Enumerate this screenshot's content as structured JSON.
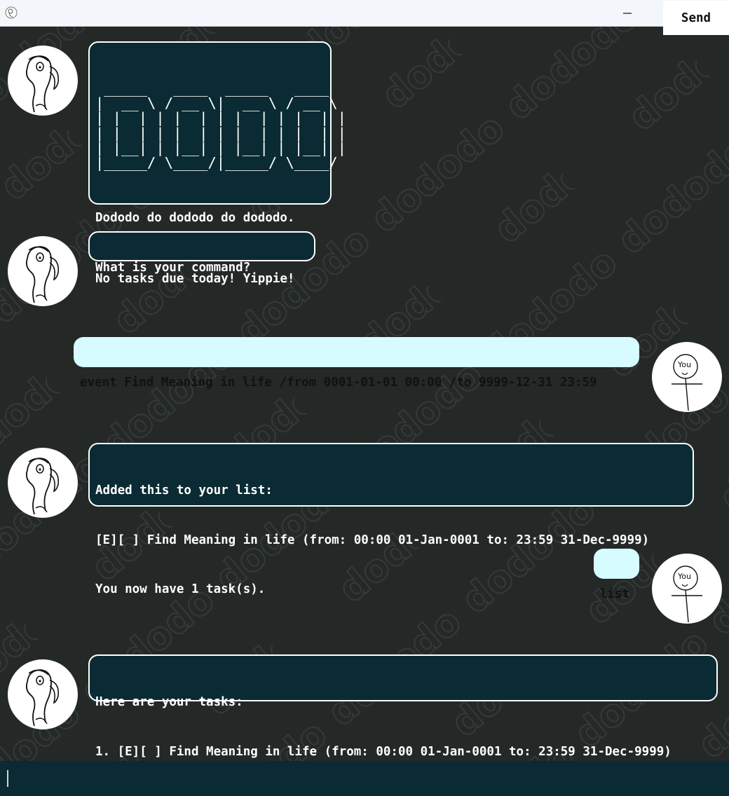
{
  "window": {
    "minimize_glyph": "—",
    "maximize_glyph": "☐",
    "close_glyph": "✕"
  },
  "messages": [
    {
      "sender": "duke",
      "ascii_art": " _____   ____  _____   ____  \n|  __ \\ / __ \\|  __ \\ / __ \\ \n| |  | | |  | | |  | | |  | |\n| |  | | |  | | |  | | |  | |\n| |__| | |__| | |__| | |__| |\n|_____/ \\____/|_____/ \\____/ ",
      "lines": [
        "Dododo do dododo do dododo.",
        "What is your command?"
      ]
    },
    {
      "sender": "duke",
      "color": "green",
      "lines": [
        "No tasks due today! Yippie!"
      ]
    },
    {
      "sender": "user",
      "lines": [
        "event Find Meaning in life /from 0001-01-01 00:00 /to 9999-12-31 23:59"
      ]
    },
    {
      "sender": "duke",
      "color": "green",
      "lines": [
        "Added this to your list:",
        "[E][ ] Find Meaning in life (from: 00:00 01-Jan-0001 to: 23:59 31-Dec-9999)",
        "You now have 1 task(s)."
      ]
    },
    {
      "sender": "user",
      "lines": [
        "list"
      ]
    },
    {
      "sender": "duke",
      "lines": [
        "Here are your tasks:",
        "1. [E][ ] Find Meaning in life (from: 00:00 01-Jan-0001 to: 23:59 31-Dec-9999)"
      ]
    }
  ],
  "user_avatar_text": "You",
  "watermark_text": "dododo",
  "input": {
    "value": "",
    "placeholder": ""
  },
  "send_label": "Send",
  "colors": {
    "background": "#242827",
    "duke_bubble": "#0a2b33",
    "user_bubble": "#d6fcff",
    "green_text": "#5ff15a",
    "input_bar": "#0a2b33"
  }
}
